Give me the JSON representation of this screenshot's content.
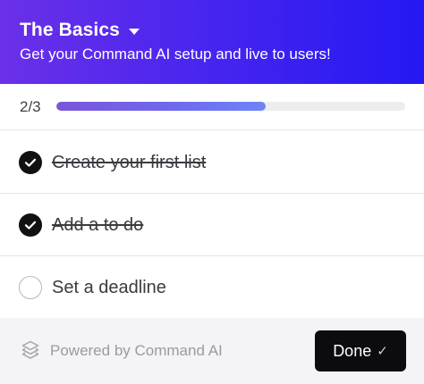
{
  "header": {
    "title": "The Basics",
    "subtitle": "Get your Command AI setup and live to users!",
    "gradient_start": "#6b30e8",
    "gradient_end": "#2418f2"
  },
  "progress": {
    "label": "2/3",
    "completed": 2,
    "total": 3,
    "fraction": 0.6
  },
  "checklist": {
    "items": [
      {
        "label": "Create your first list",
        "completed": true
      },
      {
        "label": "Add a to do",
        "completed": true
      },
      {
        "label": "Set a deadline",
        "completed": false
      }
    ]
  },
  "footer": {
    "powered_by": "Powered by Command AI",
    "powered_icon": "command-ai-logo-icon",
    "done_label": "Done",
    "done_icon": "checkmark-icon"
  }
}
